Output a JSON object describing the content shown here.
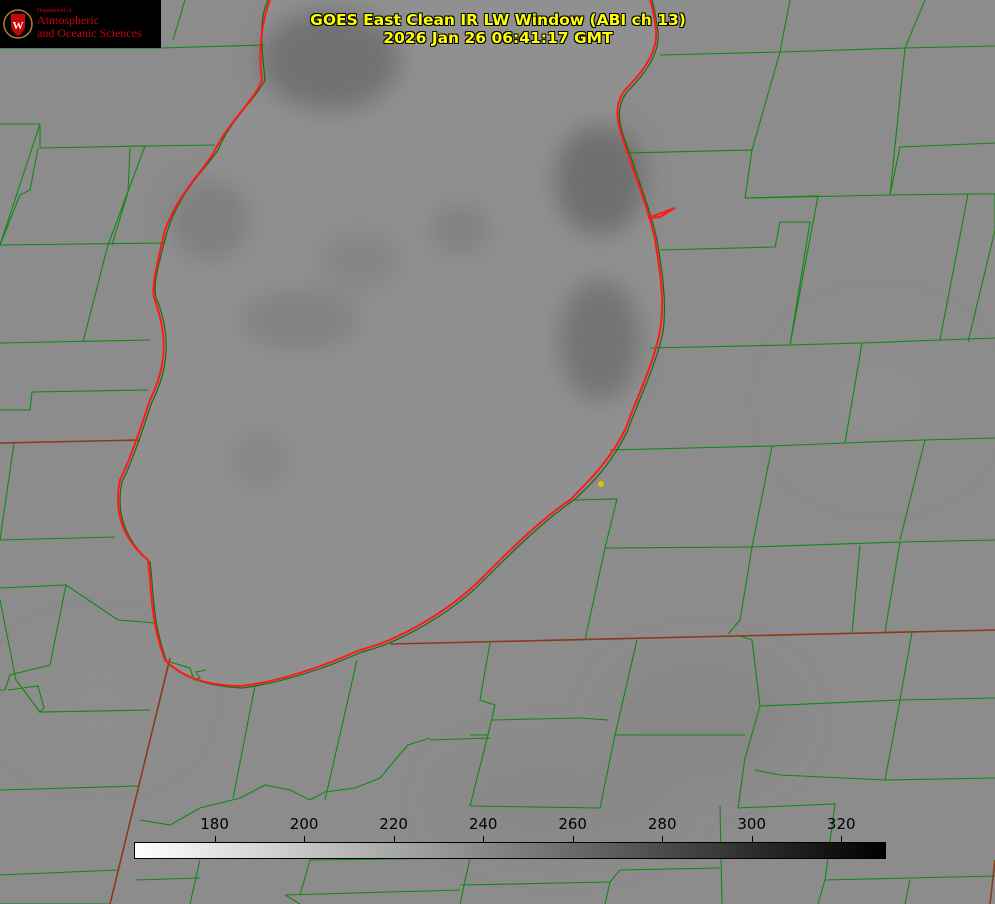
{
  "title": {
    "line1": "GOES East Clean IR LW Window (ABI ch 13)",
    "line2": "2026 Jan 26 06:41:17 GMT"
  },
  "logo": {
    "dept": "Department of",
    "line1": "Atmospheric",
    "line2": "and Oceanic Sciences",
    "seal_letter": "W",
    "color": "#c5050c"
  },
  "colorbar": {
    "min": 162,
    "max": 330,
    "ticks": [
      "180",
      "200",
      "220",
      "240",
      "260",
      "280",
      "300",
      "320"
    ],
    "colormap": "white-to-black"
  },
  "colors": {
    "background": "#8a8a8a",
    "county_lines": "#118811",
    "state_lines": "#8b3a1a",
    "lake_shoreline": "#ff1a1a",
    "title_text": "#ffff00",
    "marker": "#d8c800"
  }
}
